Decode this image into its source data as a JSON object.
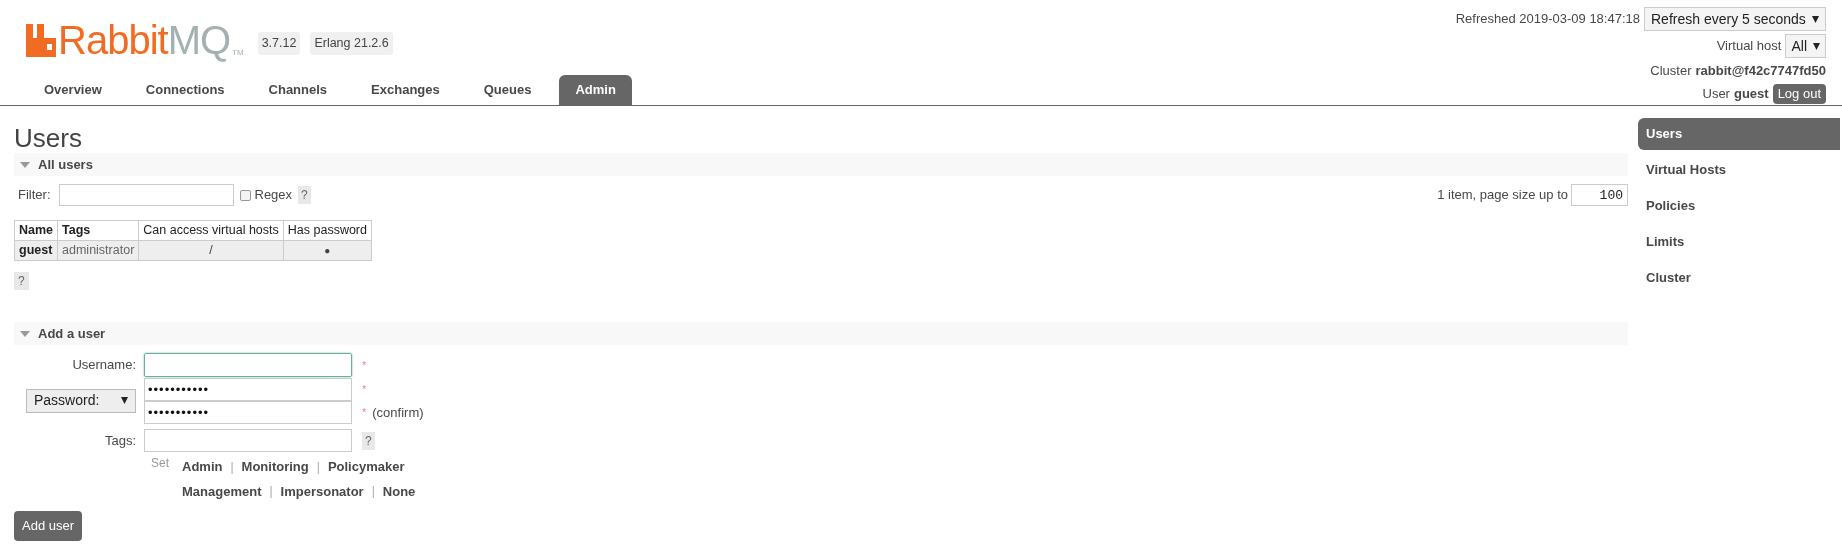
{
  "logo": {
    "part_1": "Rabbit",
    "part_2": "MQ",
    "trademark": "TM"
  },
  "badges": [
    "3.7.12",
    "Erlang 21.2.6"
  ],
  "tabs": [
    {
      "label": "Overview",
      "selected": false
    },
    {
      "label": "Connections",
      "selected": false
    },
    {
      "label": "Channels",
      "selected": false
    },
    {
      "label": "Exchanges",
      "selected": false
    },
    {
      "label": "Queues",
      "selected": false
    },
    {
      "label": "Admin",
      "selected": true
    }
  ],
  "header_right": {
    "refreshed": "Refreshed 2019-03-09 18:47:18",
    "refresh_select": "Refresh every 5 seconds",
    "vhost_label": "Virtual host",
    "vhost_select": "All",
    "cluster_label": "Cluster",
    "cluster_name": "rabbit@f42c7747fd50",
    "user_label": "User",
    "user_name": "guest",
    "logout": "Log out"
  },
  "title": "Users",
  "all_users": {
    "heading": "All users",
    "expanded": true,
    "filter_label": "Filter:",
    "regex_label": "Regex",
    "regex_checked": false,
    "help": "?",
    "paging_text": "1 item, page size up to",
    "page_size": "100",
    "columns": [
      "Name",
      "Tags",
      "Can access virtual hosts",
      "Has password"
    ],
    "rows": [
      [
        "guest",
        "administrator",
        "/",
        "●"
      ]
    ],
    "table_help": "?"
  },
  "add_user": {
    "heading": "Add a user",
    "expanded": true,
    "username_label": "Username:",
    "username_focused": true,
    "required_mark": "*",
    "password_select": "Password:",
    "password": "•••••••••••",
    "password_required_mark": "*",
    "confirm": "•••••••••••",
    "confirm_required_mark": "*",
    "confirm_note": "(confirm)",
    "tags_label": "Tags:",
    "tags_help": "?",
    "set_label": "Set",
    "tag_rows": [
      [
        {
          "kind": "link",
          "text": "Admin"
        },
        {
          "kind": "separator",
          "text": "|"
        },
        {
          "kind": "link",
          "text": "Monitoring"
        },
        {
          "kind": "separator",
          "text": "|"
        },
        {
          "kind": "link",
          "text": "Policymaker"
        }
      ],
      [
        {
          "kind": "link",
          "text": "Management"
        },
        {
          "kind": "separator",
          "text": "|"
        },
        {
          "kind": "link",
          "text": "Impersonator"
        },
        {
          "kind": "separator",
          "text": "|"
        },
        {
          "kind": "link",
          "text": "None"
        }
      ]
    ],
    "submit": "Add user"
  },
  "sidebar": [
    {
      "label": "Users",
      "selected": true
    },
    {
      "label": "Virtual Hosts",
      "selected": false
    },
    {
      "label": "Policies",
      "selected": false
    },
    {
      "label": "Limits",
      "selected": false
    },
    {
      "label": "Cluster",
      "selected": false
    }
  ]
}
